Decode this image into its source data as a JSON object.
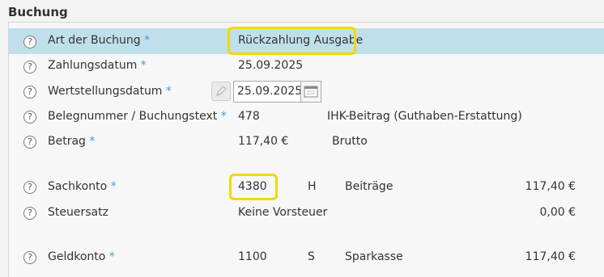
{
  "section": {
    "title": "Buchung"
  },
  "rows": {
    "art": {
      "label": "Art der Buchung",
      "required": "*",
      "value": "Rückzahlung Ausgabe"
    },
    "zahlungsdatum": {
      "label": "Zahlungsdatum",
      "required": "*",
      "value": "25.09.2025"
    },
    "wertstellung": {
      "label": "Wertstellungsdatum",
      "required": "*",
      "value": "25.09.2025"
    },
    "beleg": {
      "label": "Belegnummer / Buchungstext",
      "required": "*",
      "number": "478",
      "text": "IHK-Beitrag (Guthaben-Erstattung)"
    },
    "betrag": {
      "label": "Betrag",
      "required": "*",
      "value": "117,40 €",
      "type": "Brutto"
    },
    "sachkonto": {
      "label": "Sachkonto",
      "required": "*",
      "account": "4380",
      "side": "H",
      "name": "Beiträge",
      "amount": "117,40 €"
    },
    "steuersatz": {
      "label": "Steuersatz",
      "value": "Keine Vorsteuer",
      "amount": "0,00 €"
    },
    "geldkonto": {
      "label": "Geldkonto",
      "required": "*",
      "account": "1100",
      "side": "S",
      "name": "Sparkasse",
      "amount": "117,40 €"
    }
  },
  "icons": {
    "help": "?",
    "edit": "pencil-icon",
    "calendar": "calendar-icon"
  },
  "colors": {
    "highlight": "#bfe0ea",
    "required": "#3a9fd6",
    "callout": "#f5d800"
  }
}
